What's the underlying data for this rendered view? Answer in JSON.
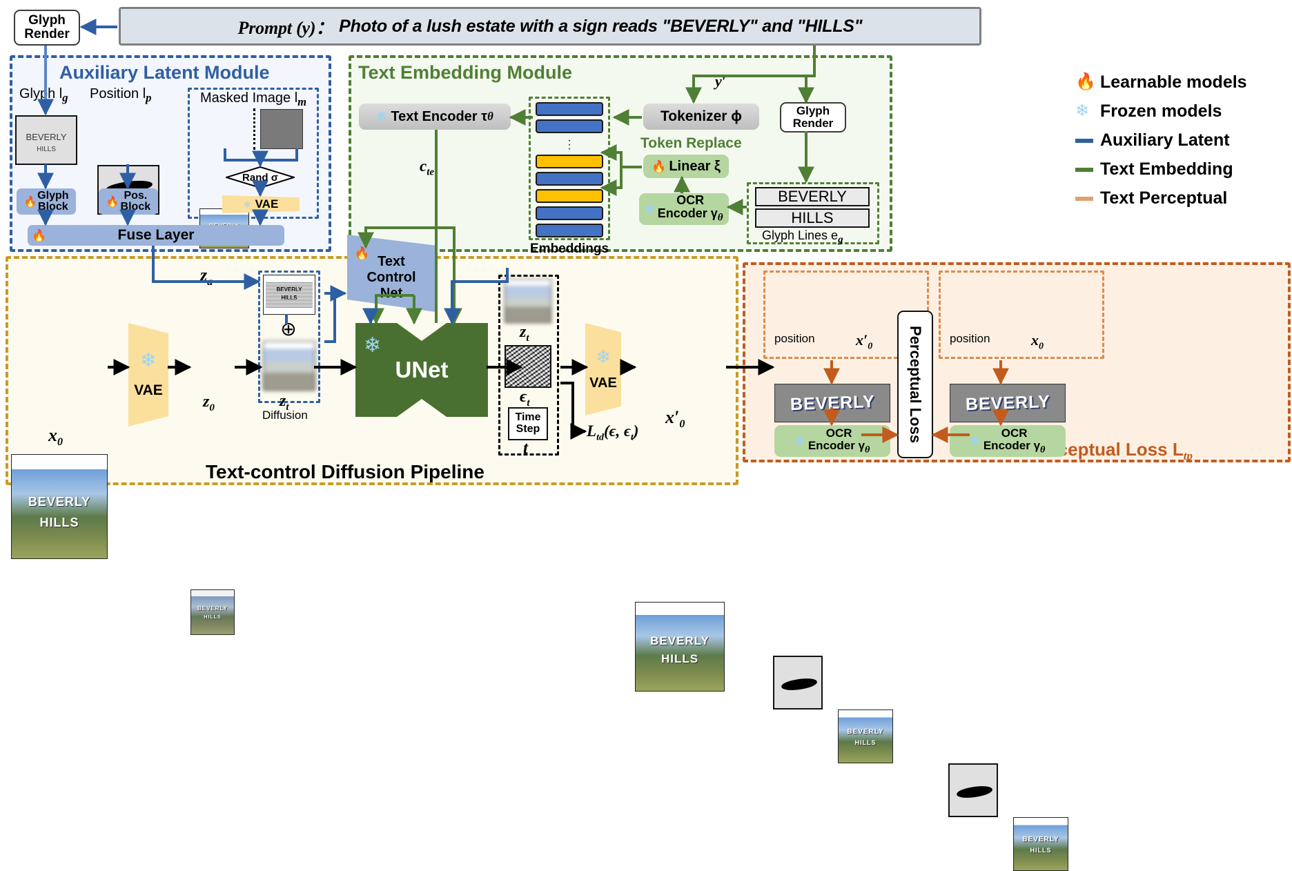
{
  "prompt": {
    "label": "Prompt (y)：",
    "text": "Photo of a lush estate with a sign reads \"BEVERLY\" and \"HILLS\""
  },
  "top_glyph_render": "Glyph\nRender",
  "aux_module": {
    "title": "Auxiliary Latent Module",
    "glyph_label": "Glyph l",
    "glyph_sub": "g",
    "position_label": "Position l",
    "position_sub": "p",
    "masked_label": "Masked Image l",
    "masked_sub": "m",
    "glyph_card_line1": "BEVERLY",
    "glyph_card_line2": "HILLS",
    "glyph_block": "Glyph\nBlock",
    "pos_block": "Pos.\nBlock",
    "rand": "Rand σ",
    "vae": "VAE",
    "fuse_layer": "Fuse Layer"
  },
  "text_embedding_module": {
    "title": "Text Embedding Module",
    "text_encoder": "Text Encoder τ",
    "text_encoder_sub": "θ",
    "c_te": "c",
    "c_te_sub": "te",
    "y_prime": "y′",
    "tokenizer": "Tokenizer ϕ",
    "token_replace": "Token Replace",
    "linear": "Linear ξ",
    "ocr_encoder_l1": "OCR",
    "ocr_encoder_l2": "Encoder γ",
    "ocr_encoder_sub": "θ",
    "embeddings_label": "Embeddings",
    "glyph_render": "Glyph\nRender",
    "glyph_line_1": "BEVERLY",
    "glyph_line_2": "HILLS",
    "glyph_lines_label": "Glyph Lines e",
    "glyph_lines_sub": "g",
    "token_colors": [
      "blue",
      "blue",
      "dots",
      "orange",
      "blue",
      "orange",
      "blue",
      "blue"
    ]
  },
  "legend": {
    "items": [
      {
        "icon": "fire-icon",
        "label": "Learnable models",
        "color": "#ef7d22"
      },
      {
        "icon": "snowflake-icon",
        "label": "Frozen models",
        "color": "#9fd4f0"
      },
      {
        "icon": "line-swatch",
        "label": "Auxiliary Latent",
        "color": "#2e5fa3"
      },
      {
        "icon": "line-swatch",
        "label": "Text Embedding",
        "color": "#4f7f34"
      },
      {
        "icon": "line-swatch",
        "label": "Text Perceptual",
        "color": "#c15b1e"
      }
    ]
  },
  "pipeline": {
    "title": "Text-control Diffusion Pipeline",
    "x0_label": "x",
    "x0_sub": "0",
    "vae_left": "VAE",
    "z0": "z",
    "z0_sub": "0",
    "zt_left": "z",
    "zt_left_sub": "t",
    "za": "z",
    "za_sub": "a",
    "diffusion_label": "Diffusion",
    "plus_symbol": "⊕",
    "text_control_net": "Text\nControl\nNet",
    "unet": "UNet",
    "zt_right": "z",
    "zt_right_sub": "t",
    "eps_t": "ϵ",
    "eps_t_sub": "t",
    "time_step": "Time\nStep",
    "time_step_t": "t",
    "loss_td": "L",
    "loss_td_sub": "td",
    "loss_td_args": "(ϵ, ϵ",
    "loss_td_args2": "t",
    "loss_td_close": ")",
    "vae_right": "VAE",
    "x0_prime": "x′",
    "x0_prime_sub": "0",
    "sign_line1": "BEVERLY",
    "sign_line2": "HILLS"
  },
  "perceptual": {
    "title": "Text Perceptual Loss L",
    "title_sub": "tp",
    "perceptual_loss": "Perceptual Loss",
    "left": {
      "position_label": "position",
      "image_label": "x′",
      "image_sub": "0",
      "crop_text": "BEVERLY",
      "ocr_l1": "OCR",
      "ocr_l2": "Encoder γ",
      "ocr_sub": "θ"
    },
    "right": {
      "position_label": "position",
      "image_label": "x",
      "image_sub": "0",
      "crop_text": "BEVERLY",
      "ocr_l1": "OCR",
      "ocr_l2": "Encoder γ",
      "ocr_sub": "θ"
    }
  },
  "colors": {
    "aux_blue": "#2e5fa3",
    "text_green": "#4f7f34",
    "perceptual_orange": "#c15b1e",
    "pipeline_yellow": "#c99a25",
    "unet_green": "#4a7031",
    "vae_yellow": "#fbdf9c",
    "controlnet_blue": "#9bb3da",
    "token_blue": "#4472c4",
    "token_orange": "#ffc000"
  }
}
